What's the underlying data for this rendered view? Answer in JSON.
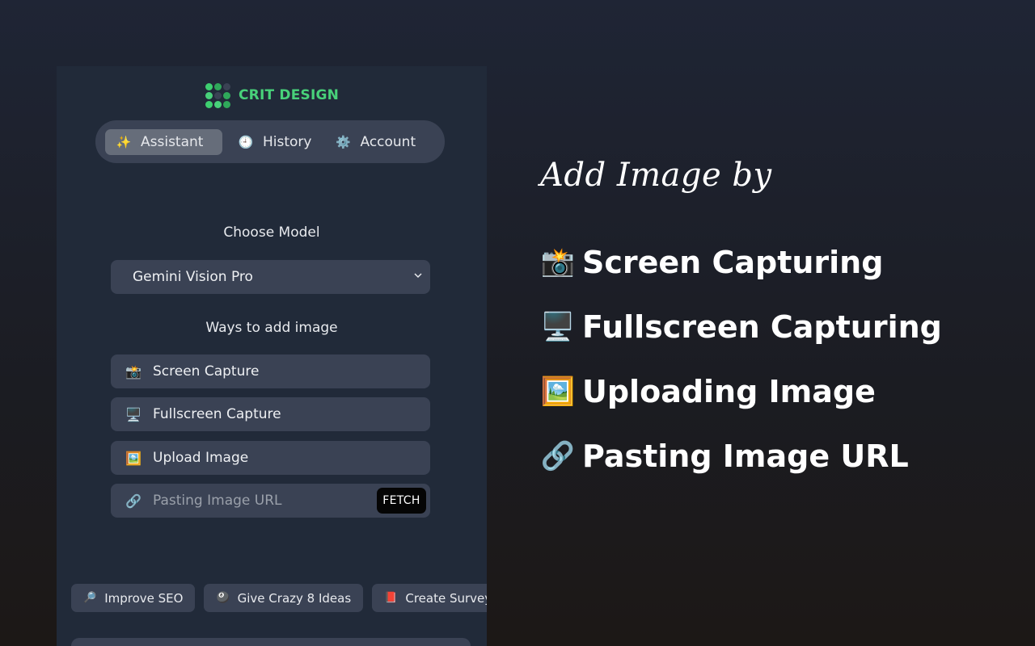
{
  "brand": {
    "name": "CRIT DESIGN",
    "logo_colors": [
      "#3ecf70",
      "#2fa85a",
      "#3a4254",
      "#48d17a",
      "#3a4254",
      "#2fa85a",
      "#3ecf70",
      "#48d17a",
      "#2fa85a"
    ]
  },
  "tabs": [
    {
      "label": "Assistant",
      "icon": "✨",
      "icon_name": "sparkles-icon",
      "active": true
    },
    {
      "label": "History",
      "icon": "🕘",
      "icon_name": "clock-icon",
      "active": false
    },
    {
      "label": "Account",
      "icon": "⚙️",
      "icon_name": "gear-icon",
      "active": false
    }
  ],
  "model": {
    "label": "Choose Model",
    "selected": "Gemini Vision Pro"
  },
  "add_image": {
    "label": "Ways to add image",
    "options": [
      {
        "label": "Screen Capture",
        "icon": "📸",
        "icon_name": "camera-flash-icon"
      },
      {
        "label": "Fullscreen Capture",
        "icon": "🖥️",
        "icon_name": "monitor-icon"
      },
      {
        "label": "Upload Image",
        "icon": "🖼️",
        "icon_name": "framed-picture-icon"
      }
    ],
    "url_input": {
      "placeholder": "Pasting Image URL",
      "icon": "🔗",
      "icon_name": "link-icon",
      "button": "FETCH"
    }
  },
  "suggestions": [
    {
      "label": "Improve SEO",
      "icon": "🔎",
      "icon_name": "magnifier-icon"
    },
    {
      "label": "Give Crazy 8 Ideas",
      "icon": "🎱",
      "icon_name": "eight-ball-icon"
    },
    {
      "label": "Create Survey",
      "icon": "📕",
      "icon_name": "book-icon"
    }
  ],
  "hero": {
    "title": "Add Image by",
    "features": [
      {
        "label": "Screen Capturing",
        "icon": "📸",
        "icon_name": "camera-flash-icon"
      },
      {
        "label": "Fullscreen Capturing",
        "icon": "🖥️",
        "icon_name": "monitor-icon"
      },
      {
        "label": "Uploading Image",
        "icon": "🖼️",
        "icon_name": "framed-picture-icon"
      },
      {
        "label": "Pasting Image URL",
        "icon": "🔗",
        "icon_name": "link-icon"
      }
    ]
  },
  "colors": {
    "accent": "#48d17a",
    "panel": "#212a39",
    "control": "#3a4254",
    "active_tab": "#666d7a"
  }
}
